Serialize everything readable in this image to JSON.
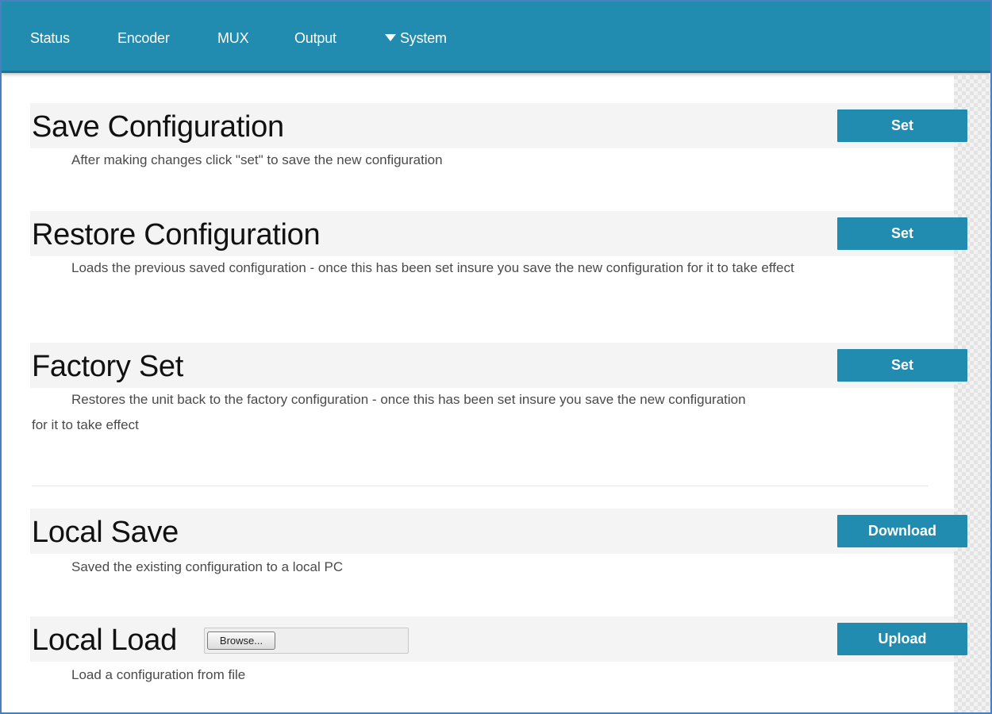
{
  "nav": {
    "items": [
      {
        "label": "Status"
      },
      {
        "label": "Encoder"
      },
      {
        "label": "MUX"
      },
      {
        "label": "Output"
      },
      {
        "label": "System",
        "icon": "caret-down-icon"
      }
    ]
  },
  "sections": {
    "save": {
      "title": "Save Configuration",
      "button": "Set",
      "description": "After making changes click \"set\" to save the new configuration"
    },
    "restore": {
      "title": "Restore Configuration",
      "button": "Set",
      "description": "Loads the previous saved configuration - once this has been set insure you save the new configuration for it to take effect"
    },
    "factory": {
      "title": "Factory Set",
      "button": "Set",
      "description": "Restores the unit back to the factory configuration - once this has been set insure you save the new configuration for it to take effect"
    },
    "local_save": {
      "title": "Local Save",
      "button": "Download",
      "description": "Saved the existing configuration to a local PC"
    },
    "local_load": {
      "title": "Local Load",
      "browse_label": "Browse...",
      "button": "Upload",
      "description": "Load a configuration from file"
    }
  },
  "colors": {
    "accent": "#228cb0",
    "nav_text": "#ffffff"
  }
}
